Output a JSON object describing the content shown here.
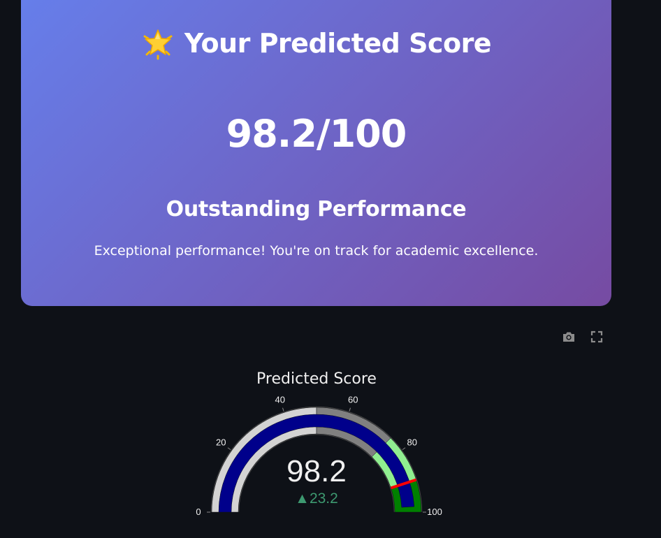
{
  "card": {
    "icon": "glowing-star-icon",
    "title": "Your Predicted Score",
    "score_text": "98.2/100",
    "level": "Outstanding Performance",
    "message": "Exceptional performance! You're on track for academic excellence.",
    "gradient_start": "#667eea",
    "gradient_end": "#764ba2"
  },
  "toolbar": {
    "items": [
      "camera-icon",
      "fullscreen-icon"
    ]
  },
  "chart_data": {
    "type": "gauge",
    "title": "Predicted Score",
    "value": 98.2,
    "value_text": "98.2",
    "delta_text": "▲23.2",
    "delta": 23.2,
    "range": [
      0,
      100
    ],
    "ticks": [
      0,
      20,
      40,
      60,
      80,
      100
    ],
    "tick_labels": [
      "0",
      "20",
      "40",
      "60",
      "80",
      "100"
    ],
    "bar_color": "#00008b",
    "threshold": 90,
    "threshold_color": "#ff0000",
    "steps": [
      {
        "range": [
          0,
          50
        ],
        "color": "#d3d3d3"
      },
      {
        "range": [
          50,
          75
        ],
        "color": "#808080"
      },
      {
        "range": [
          75,
          90
        ],
        "color": "#90ee90"
      },
      {
        "range": [
          90,
          100
        ],
        "color": "#008000"
      }
    ],
    "delta_color": "#3d9970"
  }
}
